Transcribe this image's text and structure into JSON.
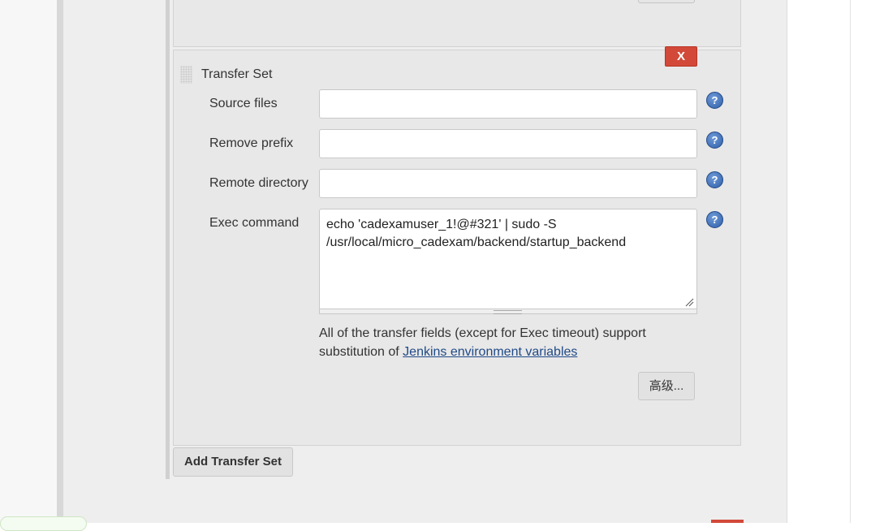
{
  "transfer_set": {
    "title": "Transfer Set",
    "delete_label": "X",
    "fields": {
      "source_files": {
        "label": "Source files",
        "value": ""
      },
      "remove_prefix": {
        "label": "Remove prefix",
        "value": ""
      },
      "remote_directory": {
        "label": "Remote directory",
        "value": ""
      },
      "exec_command": {
        "label": "Exec command",
        "value": "echo 'cadexamuser_1!@#321' | sudo -S /usr/local/micro_cadexam/backend/startup_backend"
      }
    },
    "help_icon_glyph": "?",
    "help_text_prefix": "All of the transfer fields (except for Exec timeout) support substitution of ",
    "help_link_text": "Jenkins environment variables",
    "advanced_label": "高级...",
    "add_label": "Add Transfer Set"
  },
  "icons": {
    "help": "help-question-icon",
    "drag": "drag-handle-icon",
    "resize": "resize-grip-icon"
  },
  "colors": {
    "delete_button": "#d24939",
    "help_icon": "#2f5fa8",
    "link": "#204a87",
    "panel": "#e8e8e8"
  }
}
